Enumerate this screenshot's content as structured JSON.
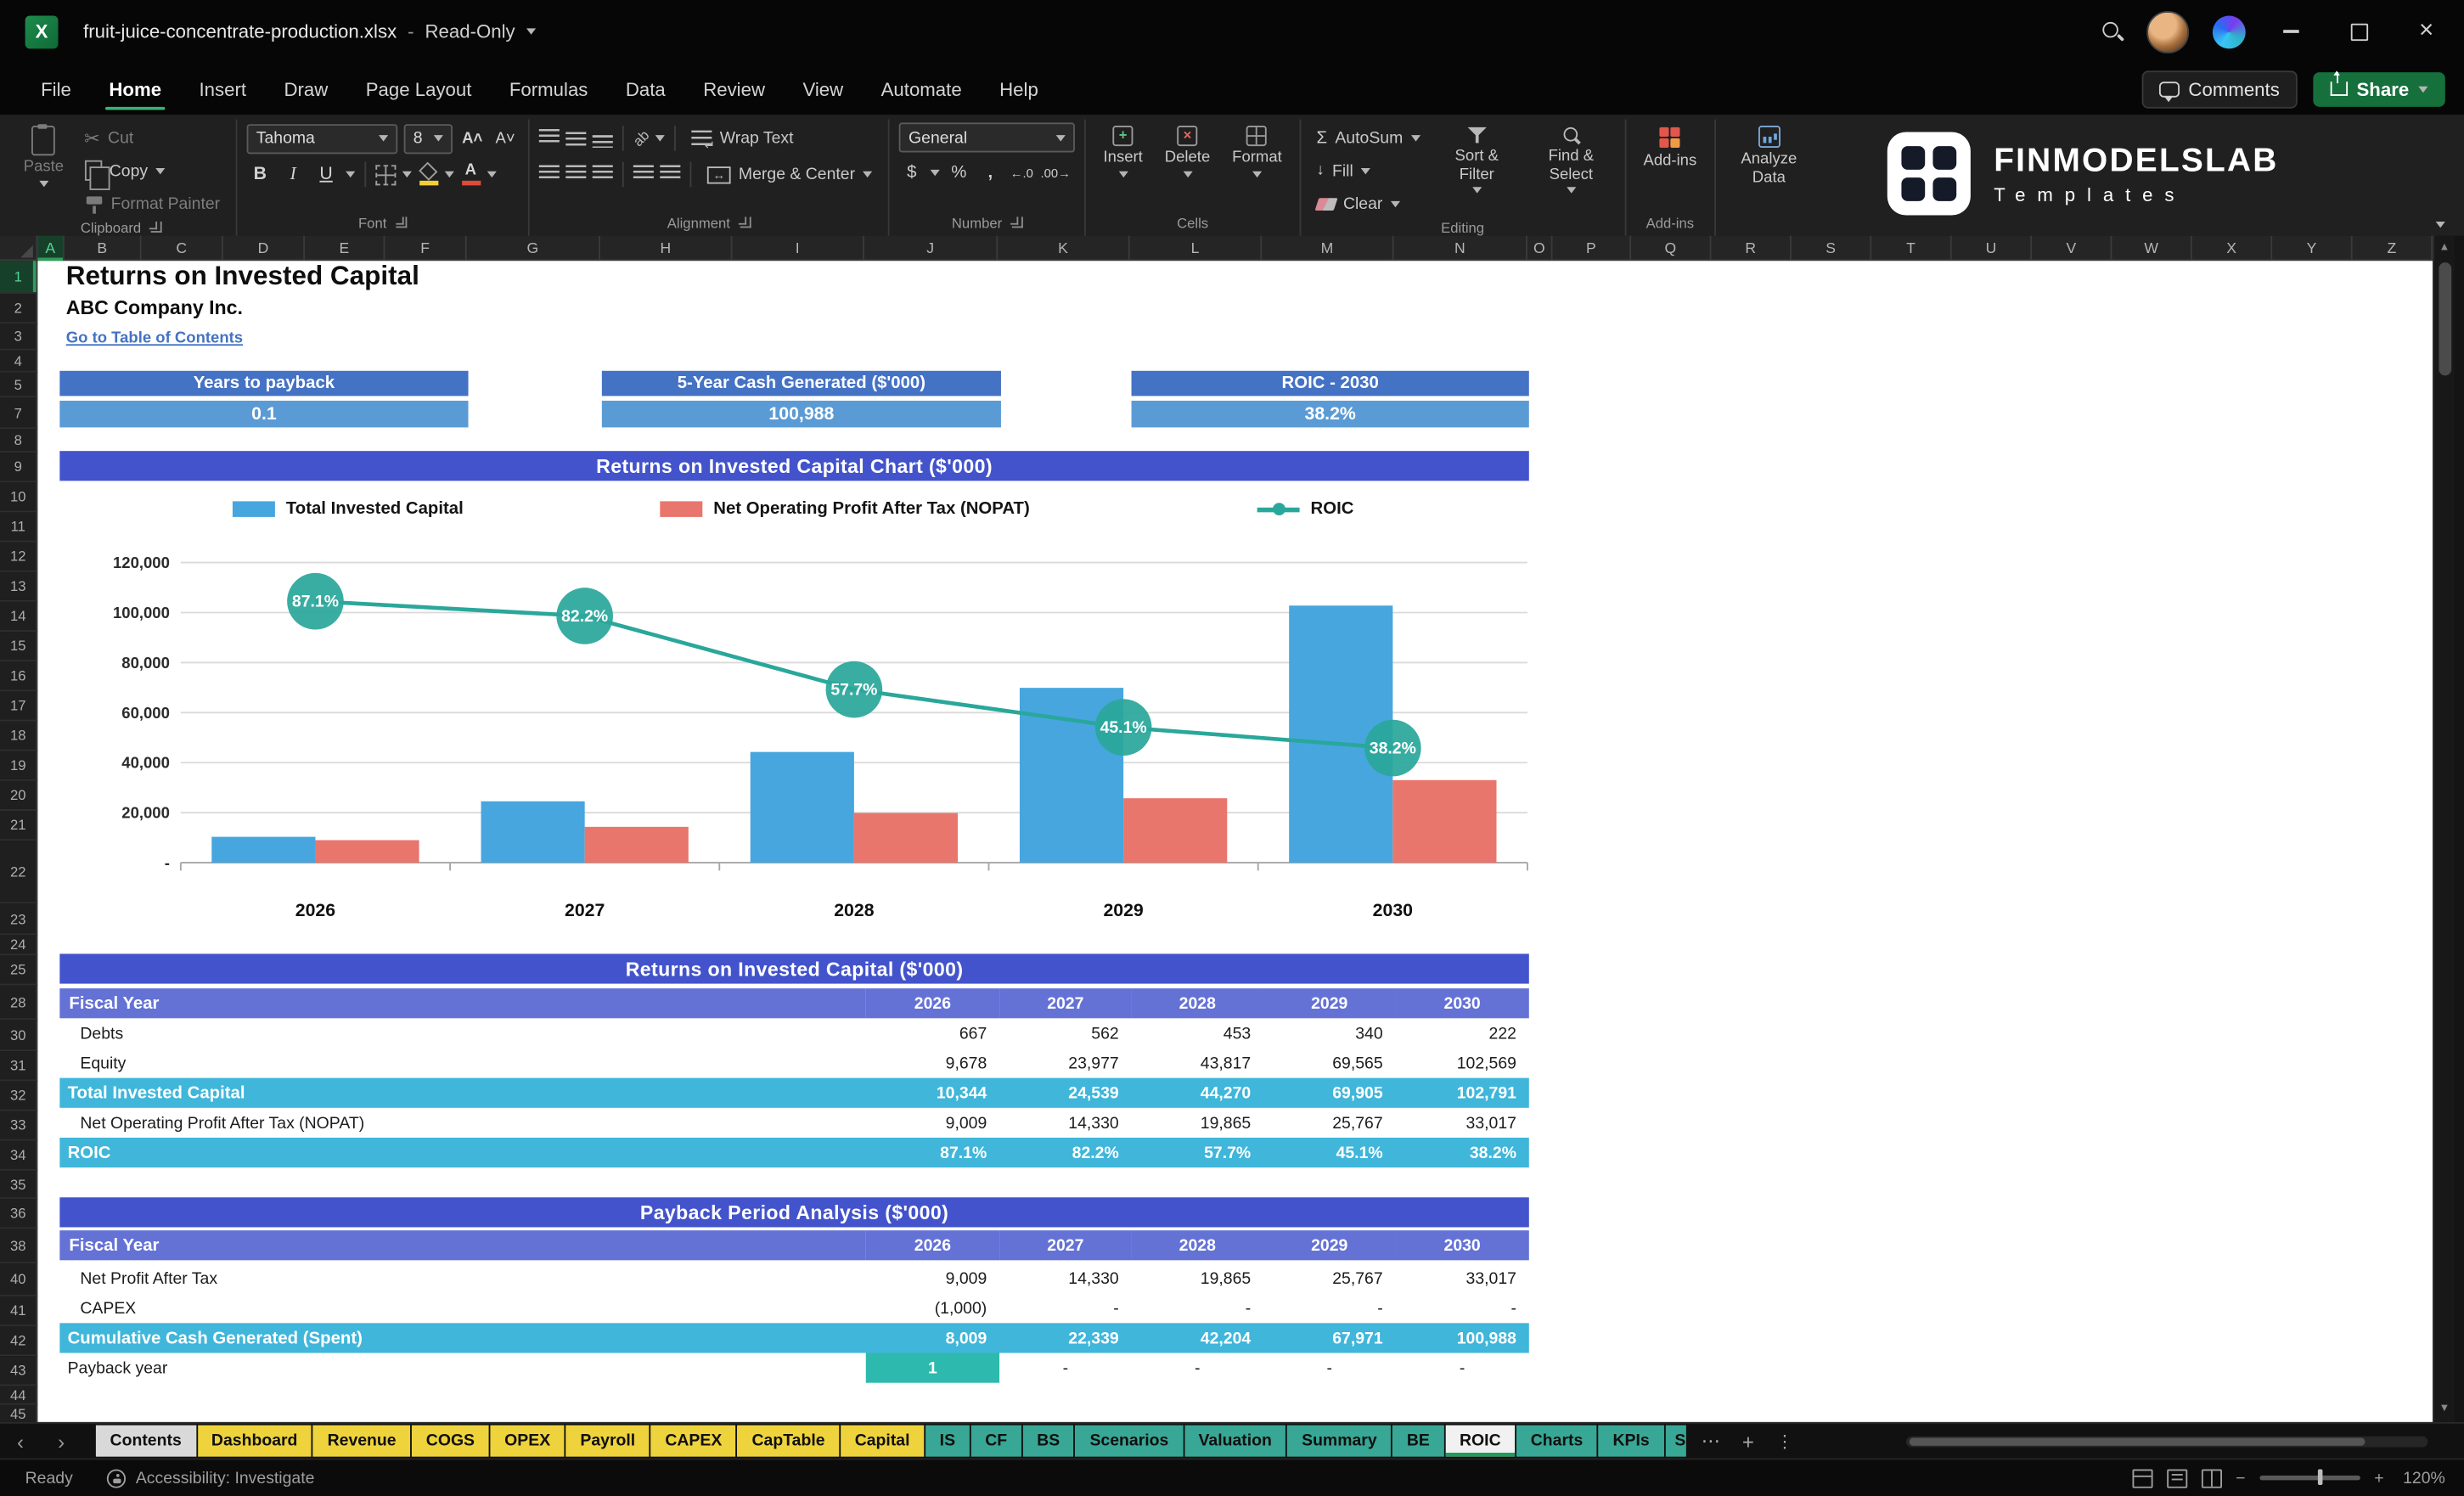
{
  "titlebar": {
    "filename": "fruit-juice-concentrate-production.xlsx",
    "separator": "-",
    "mode": "Read-Only"
  },
  "menubar": {
    "items": [
      "File",
      "Home",
      "Insert",
      "Draw",
      "Page Layout",
      "Formulas",
      "Data",
      "Review",
      "View",
      "Automate",
      "Help"
    ],
    "active": "Home",
    "comments": "Comments",
    "share": "Share"
  },
  "ribbon": {
    "clipboard": {
      "paste": "Paste",
      "cut": "Cut",
      "copy": "Copy",
      "format_painter": "Format Painter",
      "group": "Clipboard"
    },
    "font": {
      "name": "Tahoma",
      "size": "8",
      "group": "Font"
    },
    "alignment": {
      "wrap": "Wrap Text",
      "merge": "Merge & Center",
      "group": "Alignment"
    },
    "number": {
      "format": "General",
      "group": "Number"
    },
    "cells": {
      "insert": "Insert",
      "del": "Delete",
      "format": "Format",
      "group": "Cells"
    },
    "editing": {
      "autosum": "AutoSum",
      "fill": "Fill",
      "clear": "Clear",
      "sort": "Sort & Filter",
      "find": "Find & Select",
      "group": "Editing"
    },
    "addins": {
      "label": "Add-ins",
      "group": "Add-ins"
    },
    "analyze": {
      "label": "Analyze Data"
    },
    "brand": {
      "name": "FINMODELSLAB",
      "sub": "Templates"
    }
  },
  "grid": {
    "columns": [
      "A",
      "B",
      "C",
      "D",
      "E",
      "F",
      "G",
      "H",
      "I",
      "J",
      "K",
      "L",
      "M",
      "N",
      "O",
      "P",
      "Q",
      "R",
      "S",
      "T",
      "U",
      "V",
      "W",
      "X",
      "Y",
      "Z"
    ],
    "rows": [
      "1",
      "2",
      "3",
      "4",
      "5",
      "7",
      "8",
      "9",
      "10",
      "11",
      "12",
      "13",
      "14",
      "15",
      "16",
      "17",
      "18",
      "19",
      "20",
      "21",
      "22",
      "23",
      "24",
      "25",
      "28",
      "30",
      "31",
      "32",
      "33",
      "34",
      "35",
      "36",
      "38",
      "40",
      "41",
      "42",
      "43",
      "44",
      "45"
    ]
  },
  "sheet": {
    "title": "Returns on Invested Capital",
    "company": "ABC Company Inc.",
    "toc_link": "Go to Table of Contents",
    "kpis": [
      {
        "label": "Years to payback",
        "value": "0.1"
      },
      {
        "label": "5-Year Cash Generated ($'000)",
        "value": "100,988"
      },
      {
        "label": "ROIC - 2030",
        "value": "38.2%"
      }
    ],
    "tables": [
      {
        "title": "Returns on Invested Capital ($'000)",
        "fiscal_label": "Fiscal Year",
        "years": [
          "2026",
          "2027",
          "2028",
          "2029",
          "2030"
        ],
        "rows": [
          {
            "label": "Debts",
            "values": [
              "667",
              "562",
              "453",
              "340",
              "222"
            ],
            "style": "normal",
            "indent": 1
          },
          {
            "label": "Equity",
            "values": [
              "9,678",
              "23,977",
              "43,817",
              "69,565",
              "102,569"
            ],
            "style": "normal",
            "indent": 1
          },
          {
            "label": "Total Invested Capital",
            "values": [
              "10,344",
              "24,539",
              "44,270",
              "69,905",
              "102,791"
            ],
            "style": "total"
          },
          {
            "label": "Net Operating Profit After Tax (NOPAT)",
            "values": [
              "9,009",
              "14,330",
              "19,865",
              "25,767",
              "33,017"
            ],
            "style": "normal",
            "indent": 1
          },
          {
            "label": "ROIC",
            "values": [
              "87.1%",
              "82.2%",
              "57.7%",
              "45.1%",
              "38.2%"
            ],
            "style": "total"
          }
        ]
      },
      {
        "title": "Payback Period Analysis ($'000)",
        "fiscal_label": "Fiscal Year",
        "years": [
          "2026",
          "2027",
          "2028",
          "2029",
          "2030"
        ],
        "rows": [
          {
            "label": "Net Profit After Tax",
            "values": [
              "9,009",
              "14,330",
              "19,865",
              "25,767",
              "33,017"
            ],
            "style": "normal",
            "indent": 1
          },
          {
            "label": "CAPEX",
            "values": [
              "(1,000)",
              "-",
              "-",
              "-",
              "-"
            ],
            "style": "normal",
            "indent": 1
          },
          {
            "label": "Cumulative Cash Generated (Spent)",
            "values": [
              "8,009",
              "22,339",
              "42,204",
              "67,971",
              "100,988"
            ],
            "style": "total"
          },
          {
            "label": "Payback year",
            "values": [
              "1",
              "-",
              "-",
              "-",
              "-"
            ],
            "style": "payback"
          }
        ]
      }
    ]
  },
  "chart_data": {
    "type": "bar",
    "title": "Returns on Invested Capital Chart ($'000)",
    "categories": [
      "2026",
      "2027",
      "2028",
      "2029",
      "2030"
    ],
    "series": [
      {
        "name": "Total Invested Capital",
        "type": "bar",
        "color": "#47a6de",
        "values": [
          10344,
          24539,
          44270,
          69905,
          102791
        ]
      },
      {
        "name": "Net Operating Profit After Tax (NOPAT)",
        "type": "bar",
        "color": "#e8766d",
        "values": [
          9009,
          14330,
          19865,
          25767,
          33017
        ]
      },
      {
        "name": "ROIC",
        "type": "line",
        "axis": "secondary",
        "color": "#2aa79b",
        "values": [
          87.1,
          82.2,
          57.7,
          45.1,
          38.2
        ],
        "labels": [
          "87.1%",
          "82.2%",
          "57.7%",
          "45.1%",
          "38.2%"
        ]
      }
    ],
    "y_axis": {
      "min": 0,
      "max": 120000,
      "tick_interval": 20000,
      "tick_labels": [
        "-",
        "20,000",
        "40,000",
        "60,000",
        "80,000",
        "100,000",
        "120,000"
      ]
    },
    "secondary_y_axis": {
      "min": 0,
      "max": 100,
      "unit": "%",
      "visible": false
    },
    "grid": true,
    "legend_position": "top"
  },
  "sheet_tabs": {
    "tabs": [
      {
        "label": "Contents",
        "style": "gray"
      },
      {
        "label": "Dashboard",
        "style": "yellow"
      },
      {
        "label": "Revenue",
        "style": "yellow"
      },
      {
        "label": "COGS",
        "style": "yellow"
      },
      {
        "label": "OPEX",
        "style": "yellow"
      },
      {
        "label": "Payroll",
        "style": "yellow"
      },
      {
        "label": "CAPEX",
        "style": "yellow"
      },
      {
        "label": "CapTable",
        "style": "yellow"
      },
      {
        "label": "Capital",
        "style": "yellow"
      },
      {
        "label": "IS",
        "style": "teal"
      },
      {
        "label": "CF",
        "style": "teal"
      },
      {
        "label": "BS",
        "style": "teal"
      },
      {
        "label": "Scenarios",
        "style": "teal"
      },
      {
        "label": "Valuation",
        "style": "teal"
      },
      {
        "label": "Summary",
        "style": "teal"
      },
      {
        "label": "BE",
        "style": "teal"
      },
      {
        "label": "ROIC",
        "style": "active"
      },
      {
        "label": "Charts",
        "style": "teal"
      },
      {
        "label": "KPIs",
        "style": "teal"
      },
      {
        "label": "S",
        "style": "teal",
        "clipped": true
      }
    ]
  },
  "statusbar": {
    "ready": "Ready",
    "accessibility": "Accessibility: Investigate",
    "zoom": "120%"
  }
}
